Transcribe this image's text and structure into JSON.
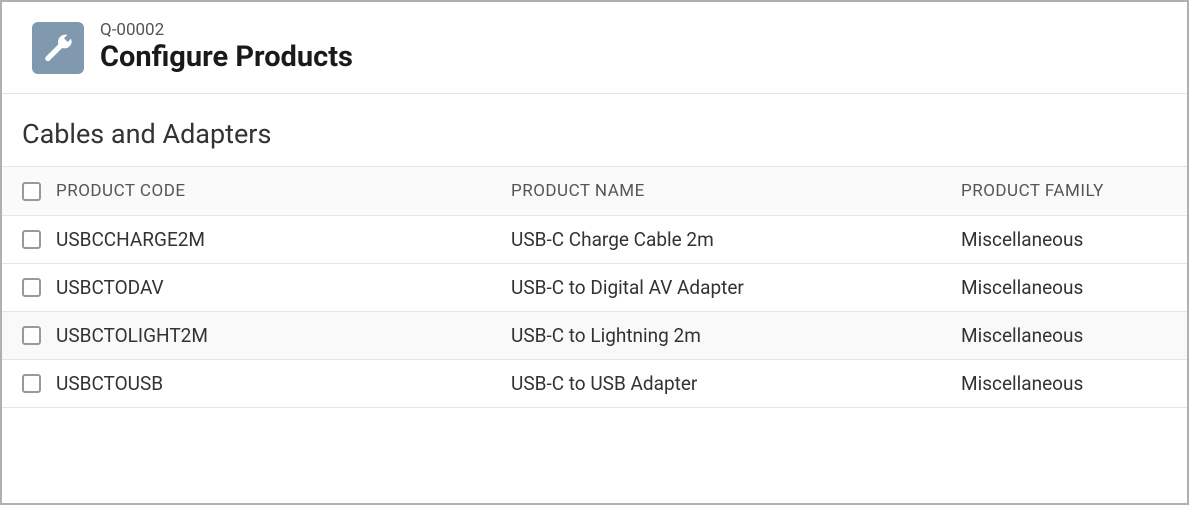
{
  "header": {
    "quote_id": "Q-00002",
    "title": "Configure Products"
  },
  "category": {
    "title": "Cables and Adapters"
  },
  "table": {
    "columns": {
      "code": "PRODUCT CODE",
      "name": "PRODUCT NAME",
      "family": "PRODUCT FAMILY"
    },
    "rows": [
      {
        "code": "USBCCHARGE2M",
        "name": "USB-C Charge Cable 2m",
        "family": "Miscellaneous"
      },
      {
        "code": "USBCTODAV",
        "name": "USB-C to Digital AV Adapter",
        "family": "Miscellaneous"
      },
      {
        "code": "USBCTOLIGHT2M",
        "name": "USB-C to Lightning 2m",
        "family": "Miscellaneous"
      },
      {
        "code": "USBCTOUSB",
        "name": "USB-C to USB Adapter",
        "family": "Miscellaneous"
      }
    ]
  }
}
